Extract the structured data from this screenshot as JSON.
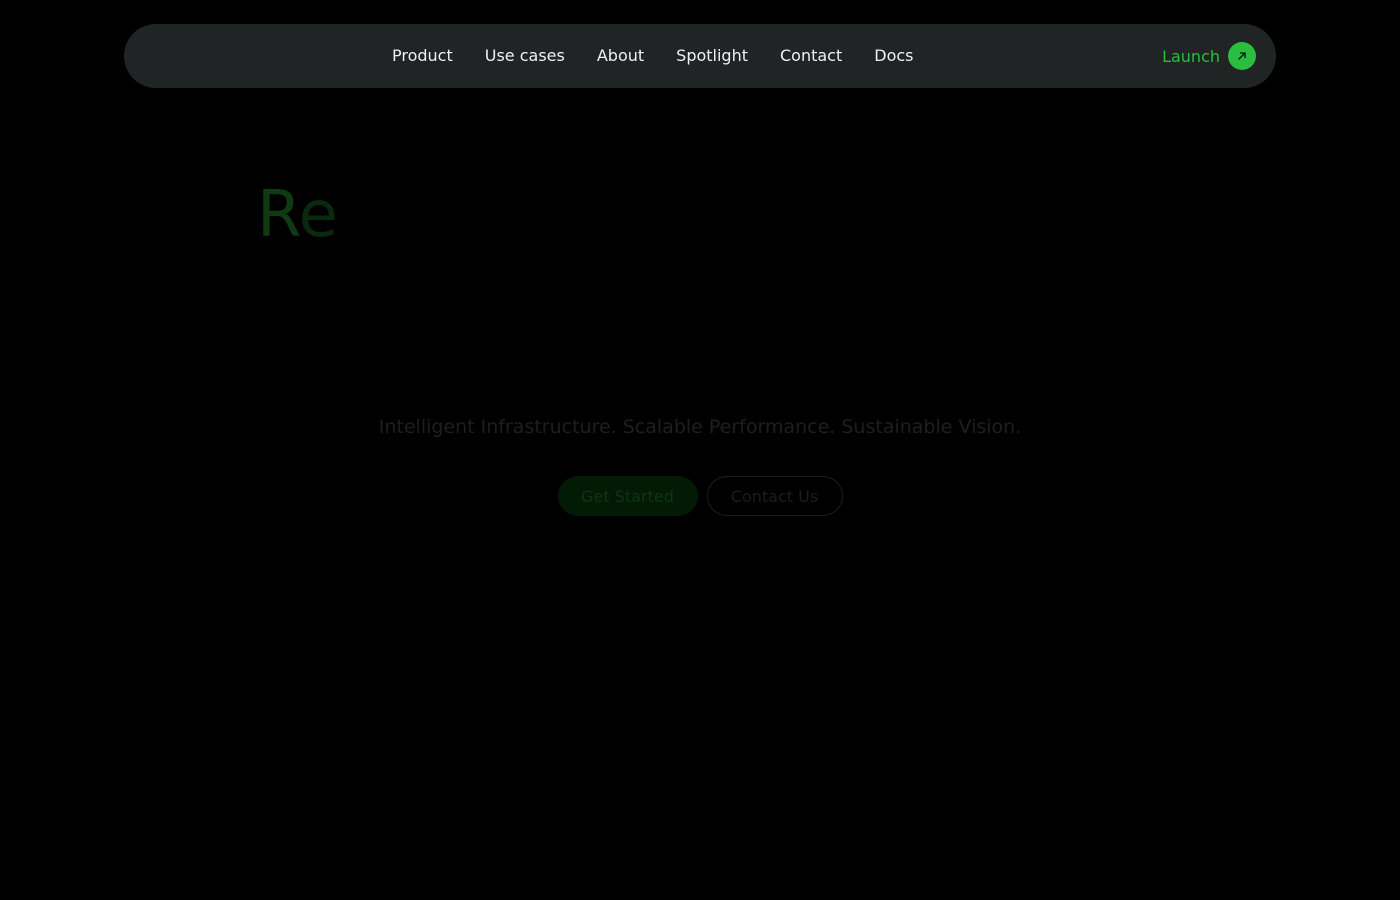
{
  "nav": {
    "links": [
      "Product",
      "Use cases",
      "About",
      "Spotlight",
      "Contact",
      "Docs"
    ],
    "launch_label": "Launch",
    "launch_icon": "arrow-up-right-icon"
  },
  "hero": {
    "heading_part1": "R",
    "heading_part2": "e",
    "tagline": "Intelligent Infrastructure. Scalable Performance. Sustainable Vision.",
    "primary_cta": "Get Started",
    "secondary_cta": "Contact Us"
  },
  "colors": {
    "background": "#000000",
    "navbar": "#202425",
    "accent": "#2bbd3f"
  }
}
